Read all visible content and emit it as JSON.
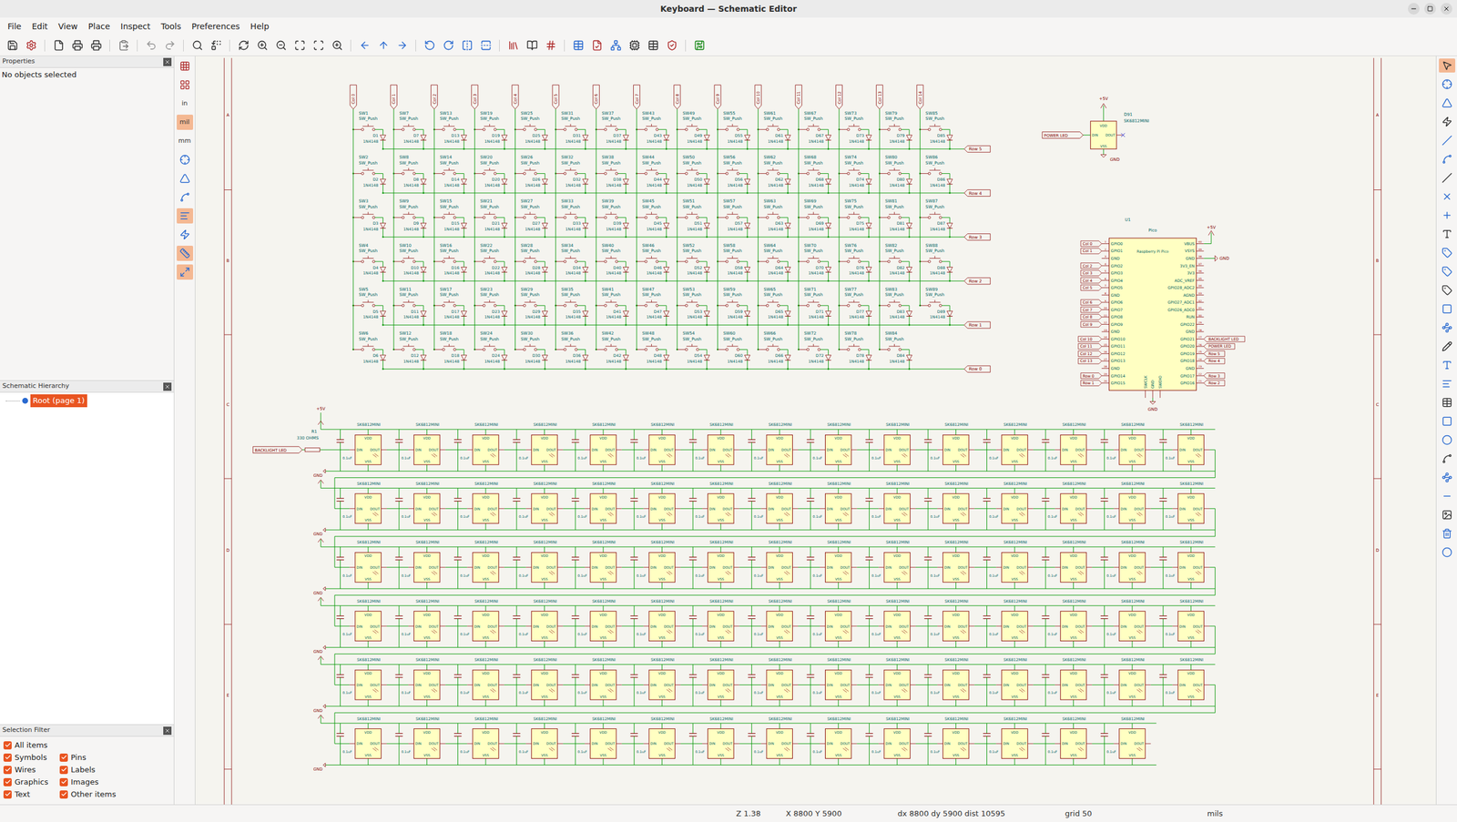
{
  "window": {
    "title": "Keyboard — Schematic Editor"
  },
  "menu": [
    "File",
    "Edit",
    "View",
    "Place",
    "Inspect",
    "Tools",
    "Preferences",
    "Help"
  ],
  "left_toolbar": {
    "tools": [
      {
        "selected": false
      },
      {
        "selected": false
      },
      {
        "selected": false
      },
      {
        "selected": false
      },
      {
        "selected": false
      },
      {
        "selected": true
      },
      {
        "selected": false
      },
      {
        "selected": true
      },
      {
        "selected": true
      }
    ],
    "units": [
      {
        "label": "in",
        "selected": false
      },
      {
        "label": "mil",
        "selected": true
      },
      {
        "label": "mm",
        "selected": false
      }
    ]
  },
  "right_toolbar": [
    {
      "selected": true
    },
    {
      "selected": false
    },
    {
      "selected": false
    },
    {
      "selected": false
    },
    {
      "selected": false
    },
    {
      "selected": false
    },
    {
      "selected": false
    },
    {
      "selected": false
    },
    {
      "selected": false
    },
    {
      "selected": false
    },
    {
      "selected": false
    },
    {
      "selected": false
    },
    {
      "selected": false
    },
    {
      "selected": false
    },
    {
      "selected": false
    },
    {
      "selected": false
    },
    {
      "selected": false
    },
    {
      "selected": false
    },
    {
      "selected": false
    },
    {
      "selected": false
    },
    {
      "selected": false
    },
    {
      "selected": false
    },
    {
      "selected": false
    },
    {
      "selected": false
    },
    {
      "selected": false
    },
    {
      "selected": false
    },
    {
      "selected": false
    }
  ],
  "properties": {
    "title": "Properties",
    "empty": "No objects selected"
  },
  "hierarchy": {
    "title": "Schematic Hierarchy",
    "items": [
      {
        "label": "Root (page 1)",
        "selected": true
      }
    ]
  },
  "selection_filter": {
    "title": "Selection Filter",
    "items": [
      {
        "label": "All items",
        "checked": true
      },
      {
        "label": "Symbols",
        "checked": true
      },
      {
        "label": "Pins",
        "checked": true
      },
      {
        "label": "Wires",
        "checked": true
      },
      {
        "label": "Labels",
        "checked": true
      },
      {
        "label": "Graphics",
        "checked": true
      },
      {
        "label": "Images",
        "checked": true
      },
      {
        "label": "Text",
        "checked": true
      },
      {
        "label": "Other items",
        "checked": true
      }
    ]
  },
  "status_bar": [
    "Z 1.38",
    "X 8800 Y 5900",
    "dx 8800 dy 5900 dist 10595",
    "grid 50",
    "mils"
  ],
  "frame_rows": [
    "A",
    "B",
    "C",
    "D",
    "E"
  ],
  "switch_matrix": {
    "switch_value": "SW_Push",
    "diode_value": "1N4148",
    "rows": [
      "Row 5",
      "Row 4",
      "Row 3",
      "Row 2",
      "Row 1",
      "Row 0"
    ],
    "columns": [
      {
        "label": "Col 0",
        "keys": [
          [
            "SW1",
            "D1"
          ],
          [
            "SW2",
            "D2"
          ],
          [
            "SW3",
            "D3"
          ],
          [
            "SW4",
            "D4"
          ],
          [
            "SW5",
            "D5"
          ],
          [
            "SW6",
            "D6"
          ]
        ]
      },
      {
        "label": "Col 1",
        "keys": [
          [
            "SW7",
            "D7"
          ],
          [
            "SW8",
            "D8"
          ],
          [
            "SW9",
            "D9"
          ],
          [
            "SW10",
            "D10"
          ],
          [
            "SW11",
            "D11"
          ],
          [
            "SW12",
            "D12"
          ]
        ]
      },
      {
        "label": "Col 2",
        "keys": [
          [
            "SW13",
            "D13"
          ],
          [
            "SW14",
            "D14"
          ],
          [
            "SW15",
            "D15"
          ],
          [
            "SW16",
            "D16"
          ],
          [
            "SW17",
            "D17"
          ],
          [
            "SW18",
            "D18"
          ]
        ]
      },
      {
        "label": "Col 3",
        "keys": [
          [
            "SW19",
            "D19"
          ],
          [
            "SW20",
            "D20"
          ],
          [
            "SW21",
            "D21"
          ],
          [
            "SW22",
            "D22"
          ],
          [
            "SW23",
            "D23"
          ],
          [
            "SW24",
            "D24"
          ]
        ]
      },
      {
        "label": "Col 4",
        "keys": [
          [
            "SW25",
            "D25"
          ],
          [
            "SW26",
            "D26"
          ],
          [
            "SW27",
            "D27"
          ],
          [
            "SW28",
            "D28"
          ],
          [
            "SW29",
            "D29"
          ],
          [
            "SW30",
            "D30"
          ]
        ]
      },
      {
        "label": "Col 5",
        "keys": [
          [
            "SW31",
            "D31"
          ],
          [
            "SW32",
            "D32"
          ],
          [
            "SW33",
            "D33"
          ],
          [
            "SW34",
            "D34"
          ],
          [
            "SW35",
            "D35"
          ],
          [
            "SW36",
            "D36"
          ]
        ]
      },
      {
        "label": "Col 6",
        "keys": [
          [
            "SW37",
            "D37"
          ],
          [
            "SW38",
            "D38"
          ],
          [
            "SW39",
            "D39"
          ],
          [
            "SW40",
            "D40"
          ],
          [
            "SW41",
            "D41"
          ],
          [
            "SW42",
            "D42"
          ]
        ]
      },
      {
        "label": "Col 7",
        "keys": [
          [
            "SW43",
            "D43"
          ],
          [
            "SW44",
            "D44"
          ],
          [
            "SW45",
            "D45"
          ],
          [
            "SW46",
            "D46"
          ],
          [
            "SW47",
            "D47"
          ],
          [
            "SW48",
            "D48"
          ]
        ]
      },
      {
        "label": "Col 8",
        "keys": [
          [
            "SW49",
            "D49"
          ],
          [
            "SW50",
            "D50"
          ],
          [
            "SW51",
            "D51"
          ],
          [
            "SW52",
            "D52"
          ],
          [
            "SW53",
            "D53"
          ],
          [
            "SW54",
            "D54"
          ]
        ]
      },
      {
        "label": "Col 9",
        "keys": [
          [
            "SW55",
            "D55"
          ],
          [
            "SW56",
            "D56"
          ],
          [
            "SW57",
            "D57"
          ],
          [
            "SW58",
            "D58"
          ],
          [
            "SW59",
            "D59"
          ],
          [
            "SW60",
            "D60"
          ]
        ]
      },
      {
        "label": "Col 10",
        "keys": [
          [
            "SW61",
            "D61"
          ],
          [
            "SW62",
            "D62"
          ],
          [
            "SW63",
            "D63"
          ],
          [
            "SW64",
            "D64"
          ],
          [
            "SW65",
            "D65"
          ],
          [
            "SW66",
            "D66"
          ]
        ]
      },
      {
        "label": "Col 11",
        "keys": [
          [
            "SW67",
            "D67"
          ],
          [
            "SW68",
            "D68"
          ],
          [
            "SW69",
            "D69"
          ],
          [
            "SW70",
            "D70"
          ],
          [
            "SW71",
            "D71"
          ],
          [
            "SW72",
            "D72"
          ]
        ]
      },
      {
        "label": "Col 12",
        "keys": [
          [
            "SW73",
            "D73"
          ],
          [
            "SW74",
            "D74"
          ],
          [
            "SW75",
            "D75"
          ],
          [
            "SW76",
            "D76"
          ],
          [
            "SW77",
            "D77"
          ],
          [
            "SW78",
            "D78"
          ]
        ]
      },
      {
        "label": "Col 13",
        "keys": [
          [
            "SW79",
            "D79"
          ],
          [
            "SW80",
            "D80"
          ],
          [
            "SW81",
            "D81"
          ],
          [
            "SW82",
            "D82"
          ],
          [
            "SW83",
            "D83"
          ],
          [
            "SW84",
            "D84"
          ]
        ]
      },
      {
        "label": "Col 14",
        "keys": [
          [
            "SW85",
            "D85"
          ],
          [
            "SW86",
            "D86"
          ],
          [
            "SW87",
            "D87"
          ],
          [
            "SW88",
            "D88"
          ],
          [
            "SW89",
            "D89"
          ]
        ]
      }
    ]
  },
  "power_led": {
    "supply": "+5V",
    "ref": "D91",
    "value": "SK6812MINI",
    "net": "POWER LED",
    "ground": "GND",
    "pins": [
      "VDD",
      "DIN",
      "DOUT",
      "VSS"
    ]
  },
  "pico": {
    "ref": "U1",
    "value": "Pico",
    "name": "Raspberry Pi Pico",
    "left_pins": [
      {
        "name": "GPIO0",
        "num": "1",
        "net": "Col 0"
      },
      {
        "name": "GPIO1",
        "num": "2",
        "net": "Col 1"
      },
      {
        "name": "GND",
        "num": "3",
        "net": ""
      },
      {
        "name": "GPIO2",
        "num": "4",
        "net": "Col 2"
      },
      {
        "name": "GPIO3",
        "num": "5",
        "net": "Col 3"
      },
      {
        "name": "GPIO4",
        "num": "6",
        "net": "Col 4"
      },
      {
        "name": "GPIO5",
        "num": "7",
        "net": "Col 5"
      },
      {
        "name": "GND",
        "num": "8",
        "net": ""
      },
      {
        "name": "GPIO6",
        "num": "9",
        "net": "Col 6"
      },
      {
        "name": "GPIO7",
        "num": "10",
        "net": "Col 7"
      },
      {
        "name": "GPIO8",
        "num": "11",
        "net": "Col 8"
      },
      {
        "name": "GPIO9",
        "num": "12",
        "net": "Col 9"
      },
      {
        "name": "GND",
        "num": "13",
        "net": ""
      },
      {
        "name": "GPIO10",
        "num": "14",
        "net": "Col 10"
      },
      {
        "name": "GPIO11",
        "num": "15",
        "net": "Col 11"
      },
      {
        "name": "GPIO12",
        "num": "16",
        "net": "Col 12"
      },
      {
        "name": "GPIO13",
        "num": "17",
        "net": "Col 13"
      },
      {
        "name": "GND",
        "num": "18",
        "net": ""
      },
      {
        "name": "GPIO14",
        "num": "19",
        "net": "Row 0"
      },
      {
        "name": "GPIO15",
        "num": "20",
        "net": "Row 1"
      }
    ],
    "right_pins": [
      {
        "name": "VBUS",
        "num": "40",
        "net": "",
        "power": "+5V"
      },
      {
        "name": "VSYS",
        "num": "39",
        "net": "",
        "power": ""
      },
      {
        "name": "GND",
        "num": "38",
        "net": "",
        "power": "GND"
      },
      {
        "name": "3V3_EN",
        "num": "37",
        "net": "",
        "power": ""
      },
      {
        "name": "3V3",
        "num": "36",
        "net": "",
        "power": ""
      },
      {
        "name": "ADC_VREF",
        "num": "35",
        "net": "",
        "power": ""
      },
      {
        "name": "GPIO28_ADC2",
        "num": "34",
        "net": "",
        "power": ""
      },
      {
        "name": "AGND",
        "num": "33",
        "net": "",
        "power": ""
      },
      {
        "name": "GPIO27_ADC1",
        "num": "32",
        "net": "",
        "power": ""
      },
      {
        "name": "GPIO26_ADC0",
        "num": "31",
        "net": "",
        "power": ""
      },
      {
        "name": "RUN",
        "num": "30",
        "net": "",
        "power": ""
      },
      {
        "name": "GPIO22",
        "num": "29",
        "net": "",
        "power": ""
      },
      {
        "name": "GND",
        "num": "28",
        "net": "",
        "power": ""
      },
      {
        "name": "GPIO21",
        "num": "27",
        "net": "BACKLIGHT LED",
        "power": ""
      },
      {
        "name": "GPIO20",
        "num": "26",
        "net": "POWER LED",
        "power": ""
      },
      {
        "name": "GPIO19",
        "num": "25",
        "net": "Row 5",
        "power": ""
      },
      {
        "name": "GPIO18",
        "num": "24",
        "net": "Row 4",
        "power": ""
      },
      {
        "name": "GND",
        "num": "23",
        "net": "",
        "power": ""
      },
      {
        "name": "GPIO17",
        "num": "22",
        "net": "Row 3",
        "power": ""
      },
      {
        "name": "GPIO16",
        "num": "21",
        "net": "Row 2",
        "power": ""
      }
    ],
    "bottom_pins": [
      {
        "name": "SWCLK",
        "power": ""
      },
      {
        "name": "GND",
        "power": "GND"
      },
      {
        "name": "SWDIO",
        "power": ""
      }
    ]
  },
  "backlight": {
    "supply": "+5V",
    "ground": "GND",
    "net": "BACKLIGHT LED",
    "resistor": {
      "ref": "R1",
      "value": "330 OHMS"
    },
    "cap_value": "0.1uF",
    "pins": [
      "VDD",
      "DIN",
      "DOUT",
      "VSS"
    ],
    "rows": [
      [
        "SK6812MINI",
        "SK6812MINI",
        "SK6812MINI",
        "SK6812MINI",
        "SK6812MINI",
        "SK6812MINI",
        "SK6812MINI",
        "SK6812MINI",
        "SK6812MINI",
        "SK6812MINI",
        "SK6812MINI",
        "SK6812MINI",
        "SK6812MINI",
        "SK6812MINI",
        "SK6812MINI"
      ],
      [
        "SK6812MINI",
        "SK6812MINI",
        "SK6812MINI",
        "SK6812MINI",
        "SK6812MINI",
        "SK6812MINI",
        "SK6812MINI",
        "SK6812MINI",
        "SK6812MINI",
        "SK6812MINI",
        "SK6812MINI",
        "SK6812MINI",
        "SK6812MINI",
        "SK6812MINI",
        "SK6812MINI"
      ],
      [
        "SK6812MINI",
        "SK6812MINI",
        "SK6812MINI",
        "SK6812MINI",
        "SK6812MINI",
        "SK6812MINI",
        "SK6812MINI",
        "SK6812MINI",
        "SK6812MINI",
        "SK6812MINI",
        "SK6812MINI",
        "SK6812MINI",
        "SK6812MINI",
        "SK6812MINI",
        "SK6812MINI"
      ],
      [
        "SK6812MINI",
        "SK6812MINI",
        "SK6812MINI",
        "SK6812MINI",
        "SK6812MINI",
        "SK6812MINI",
        "SK6812MINI",
        "SK6812MINI",
        "SK6812MINI",
        "SK6812MINI",
        "SK6812MINI",
        "SK6812MINI",
        "SK6812MINI",
        "SK6812MINI",
        "SK6812MINI"
      ],
      [
        "SK6812MINI",
        "SK6812MINI",
        "SK6812MINI",
        "SK6812MINI",
        "SK6812MINI",
        "SK6812MINI",
        "SK6812MINI",
        "SK6812MINI",
        "SK6812MINI",
        "SK6812MINI",
        "SK6812MINI",
        "SK6812MINI",
        "SK6812MINI",
        "SK6812MINI",
        "SK6812MINI"
      ],
      [
        "SK6812MINI",
        "SK6812MINI",
        "SK6812MINI",
        "SK6812MINI",
        "SK6812MINI",
        "SK6812MINI",
        "SK6812MINI",
        "SK6812MINI",
        "SK6812MINI",
        "SK6812MINI",
        "SK6812MINI",
        "SK6812MINI",
        "SK6812MINI",
        "SK6812MINI"
      ]
    ]
  }
}
